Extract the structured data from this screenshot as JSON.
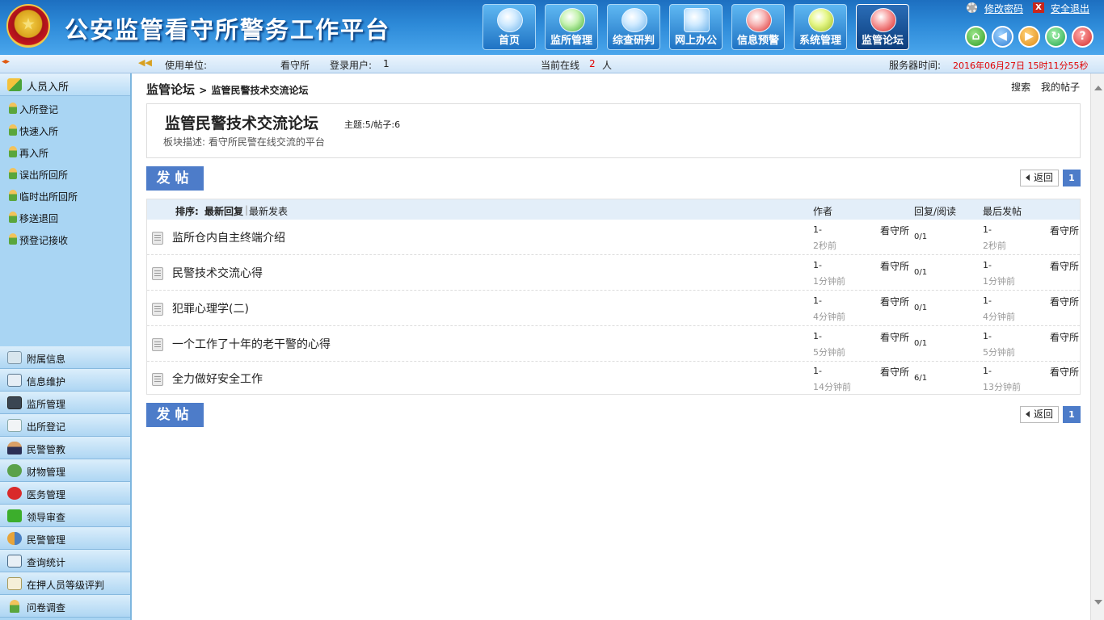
{
  "app": {
    "title": "公安监管看守所警务工作平台"
  },
  "nav": [
    {
      "label": "首页",
      "icon": "home-icon",
      "active": false
    },
    {
      "label": "监所管理",
      "icon": "pen-icon",
      "active": false
    },
    {
      "label": "综查研判",
      "icon": "magnifier-icon",
      "active": false
    },
    {
      "label": "网上办公",
      "icon": "monitor-icon",
      "active": false
    },
    {
      "label": "信息预警",
      "icon": "alert-icon",
      "active": false
    },
    {
      "label": "系统管理",
      "icon": "gear-icon",
      "active": false
    },
    {
      "label": "监管论坛",
      "icon": "forum-icon",
      "active": true
    }
  ],
  "top_links": {
    "change_password": "修改密码",
    "logout": "安全退出"
  },
  "infobar": {
    "unit_label": "使用单位:",
    "unit_value": "看守所",
    "user_label": "登录用户:",
    "user_value": "1",
    "online_label": "当前在线",
    "online_count": "2",
    "online_unit": "人",
    "server_time_label": "服务器时间:",
    "server_time_value": "2016年06月27日 15时11分55秒"
  },
  "sidebar": {
    "section_title": "人员入所",
    "sub_items": [
      "入所登记",
      "快速入所",
      "再入所",
      "误出所回所",
      "临时出所回所",
      "移送退回",
      "预登记接收"
    ],
    "items": [
      {
        "label": "附属信息",
        "icon": "attachment-icon"
      },
      {
        "label": "信息维护",
        "icon": "id-card-icon"
      },
      {
        "label": "监所管理",
        "icon": "monitor-icon"
      },
      {
        "label": "出所登记",
        "icon": "edit-icon"
      },
      {
        "label": "民警管教",
        "icon": "officer-icon"
      },
      {
        "label": "财物管理",
        "icon": "money-icon"
      },
      {
        "label": "医务管理",
        "icon": "medical-icon"
      },
      {
        "label": "领导审查",
        "icon": "check-icon"
      },
      {
        "label": "民警管理",
        "icon": "users-icon"
      },
      {
        "label": "查询统计",
        "icon": "search-icon"
      },
      {
        "label": "在押人员等级评判",
        "icon": "rating-icon"
      },
      {
        "label": "问卷调查",
        "icon": "survey-icon"
      }
    ]
  },
  "breadcrumb": {
    "root": "监管论坛",
    "separator": ">",
    "current": "监管民警技术交流论坛"
  },
  "right_links": {
    "search": "搜索",
    "my_posts": "我的帖子"
  },
  "forum": {
    "title": "监管民警技术交流论坛",
    "stats": "主题:5/帖子:6",
    "description": "板块描述: 看守所民警在线交流的平台"
  },
  "buttons": {
    "post": "发帖",
    "back": "返回",
    "page": "1"
  },
  "table": {
    "sort_label": "排序:",
    "sort_latest_reply": "最新回复",
    "sort_latest_post": "最新发表",
    "col_author": "作者",
    "col_replies": "回复/阅读",
    "col_last": "最后发帖",
    "rows": [
      {
        "subject": "监所仓内自主终端介绍",
        "author_id": "1-",
        "author_time": "2秒前",
        "author_name": "看守所",
        "replies": "0/1",
        "last_id": "1-",
        "last_time": "2秒前",
        "last_name": "看守所"
      },
      {
        "subject": "民警技术交流心得",
        "author_id": "1-",
        "author_time": "1分钟前",
        "author_name": "看守所",
        "replies": "0/1",
        "last_id": "1-",
        "last_time": "1分钟前",
        "last_name": "看守所"
      },
      {
        "subject": "犯罪心理学(二)",
        "author_id": "1-",
        "author_time": "4分钟前",
        "author_name": "看守所",
        "replies": "0/1",
        "last_id": "1-",
        "last_time": "4分钟前",
        "last_name": "看守所"
      },
      {
        "subject": "一个工作了十年的老干警的心得",
        "author_id": "1-",
        "author_time": "5分钟前",
        "author_name": "看守所",
        "replies": "0/1",
        "last_id": "1-",
        "last_time": "5分钟前",
        "last_name": "看守所"
      },
      {
        "subject": "全力做好安全工作",
        "author_id": "1-",
        "author_time": "14分钟前",
        "author_name": "看守所",
        "replies": "6/1",
        "last_id": "1-",
        "last_time": "13分钟前",
        "last_name": "看守所"
      }
    ]
  },
  "colors": {
    "header": "#2d8ad8",
    "sidebar": "#a9d5f3",
    "button": "#4d7cc9",
    "online_count": "#e00000",
    "server_time": "#e00000"
  }
}
